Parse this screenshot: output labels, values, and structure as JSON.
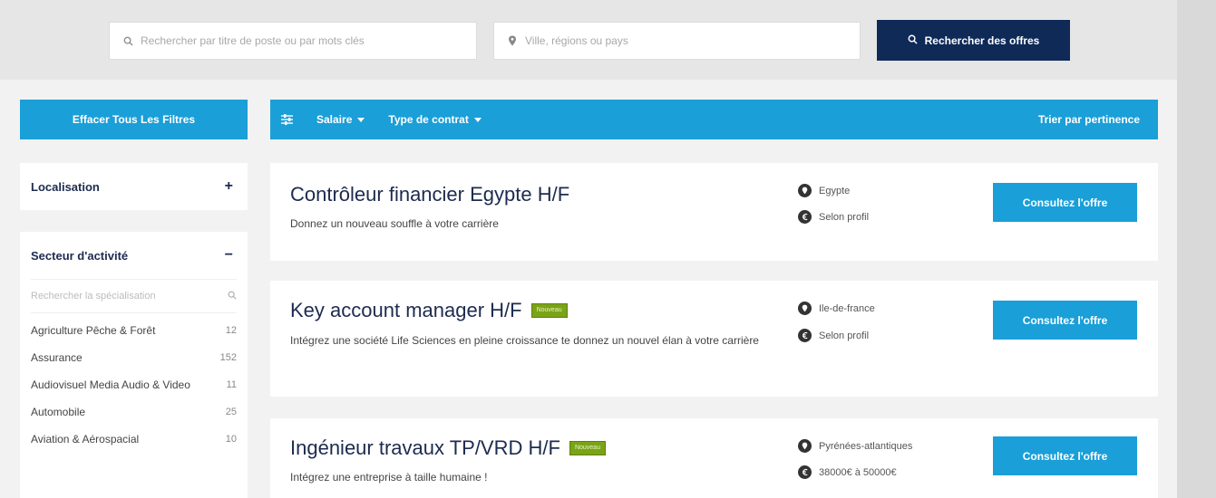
{
  "search": {
    "keyword_placeholder": "Rechercher par titre de poste ou par mots clés",
    "location_placeholder": "Ville, régions ou pays",
    "button_label": "Rechercher des offres"
  },
  "filters": {
    "clear_label": "Effacer Tous Les Filtres",
    "salary_label": "Salaire",
    "contract_label": "Type de contrat",
    "sort_label": "Trier par pertinence"
  },
  "sidebar": {
    "location": {
      "label": "Localisation",
      "sign": "+"
    },
    "sector": {
      "label": "Secteur d'activité",
      "sign": "−",
      "search_placeholder": "Rechercher la spécialisation",
      "items": [
        {
          "name": "Agriculture Pêche & Forêt",
          "count": "12"
        },
        {
          "name": "Assurance",
          "count": "152"
        },
        {
          "name": "Audiovisuel Media Audio & Video",
          "count": "11"
        },
        {
          "name": "Automobile",
          "count": "25"
        },
        {
          "name": "Aviation & Aérospacial",
          "count": "10"
        }
      ]
    }
  },
  "jobs": [
    {
      "title": "Contrôleur financier Egypte H/F",
      "badge": "",
      "description": "Donnez un nouveau souffle à votre carrière",
      "location": "Egypte",
      "salary": "Selon profil",
      "cta": "Consultez l'offre"
    },
    {
      "title": "Key account manager H/F",
      "badge": "Nouveau",
      "description": "Intégrez une société Life Sciences en pleine croissance te donnez un nouvel élan à votre carrière",
      "location": "Ile-de-france",
      "salary": "Selon profil",
      "cta": "Consultez l'offre"
    },
    {
      "title": "Ingénieur travaux TP/VRD H/F",
      "badge": "Nouveau",
      "description": "Intégrez une entreprise à taille humaine !",
      "location": "Pyrénées-atlantiques",
      "salary": "38000€ à 50000€",
      "cta": "Consultez l'offre"
    }
  ],
  "colors": {
    "primary": "#1a9fd8",
    "navy": "#0f2a57",
    "badge": "#7aa317"
  }
}
